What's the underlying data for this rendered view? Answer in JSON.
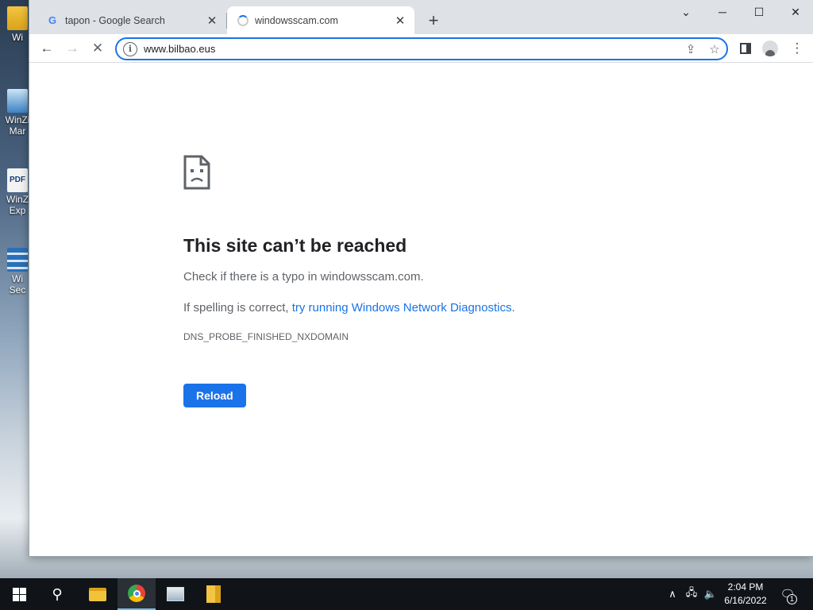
{
  "desktop": {
    "icons": [
      {
        "label": "Wi",
        "icon": "winzip-folder-icon"
      },
      {
        "label": "WinZi",
        "label2": "Mar",
        "icon": "winzip-image-manager-icon"
      },
      {
        "label": "WinZ",
        "label2": "Exp",
        "icon": "winzip-pdf-express-icon"
      },
      {
        "label": "Wi",
        "label2": "Sec",
        "icon": "winzip-secure-icon"
      }
    ],
    "pdf_badge": "PDF"
  },
  "browser": {
    "tabs": [
      {
        "title": "tapon - Google Search",
        "favicon": "G",
        "active": false
      },
      {
        "title": "windowsscam.com",
        "favicon": "loading-spinner",
        "active": true
      }
    ],
    "address_bar": {
      "value": "www.bilbao.eus"
    },
    "icons": {
      "back": "←",
      "forward": "→",
      "stop": "✕",
      "info": "i",
      "share": "⇪",
      "star": "☆",
      "menu": "⋮",
      "close_tab": "✕",
      "new_tab": "+",
      "tab_search": "⌄",
      "minimize": "─",
      "maximize": "☐",
      "close_window": "✕"
    }
  },
  "error_page": {
    "title": "This site can’t be reached",
    "line1": "Check if there is a typo in windowsscam.com.",
    "line2_prefix": "If spelling is correct, ",
    "line2_link": "try running Windows Network Diagnostics",
    "line2_suffix": ".",
    "error_code": "DNS_PROBE_FINISHED_NXDOMAIN",
    "reload_label": "Reload"
  },
  "taskbar": {
    "search_glyph": "⚲",
    "tray": {
      "up": "∧",
      "network": "🖧",
      "volume": "🔈",
      "notifications": "🗨",
      "notification_count": "1"
    },
    "time": "2:04 PM",
    "date": "6/16/2022"
  },
  "colors": {
    "accent": "#1a73e8",
    "taskbar": "#101418",
    "tabstrip": "#dee1e6"
  }
}
